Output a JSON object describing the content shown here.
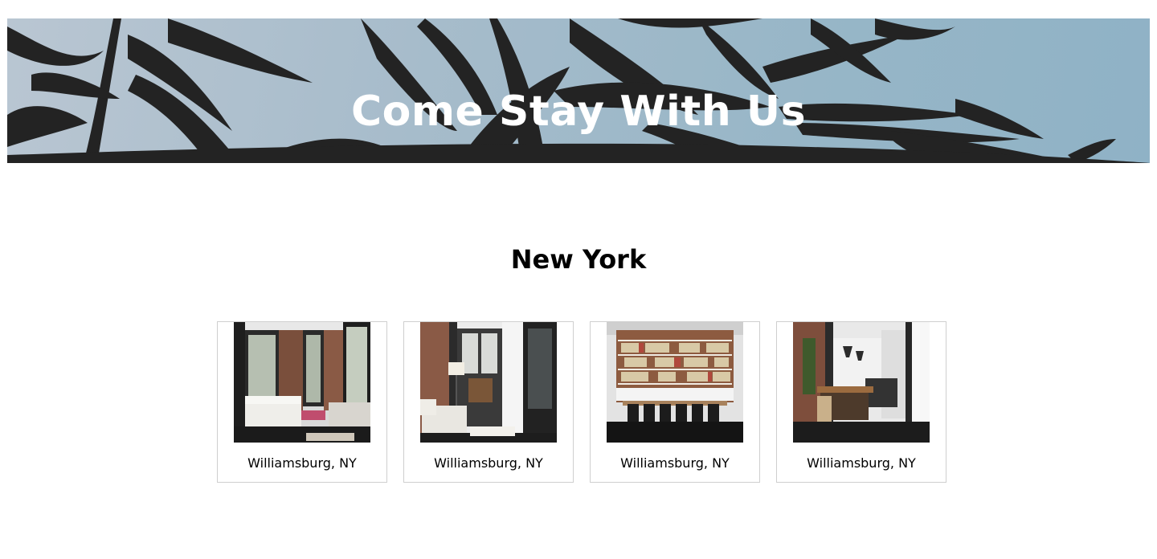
{
  "hero": {
    "title": "Come Stay With Us"
  },
  "section": {
    "title": "New York"
  },
  "listings": [
    {
      "caption": "Williamsburg, NY",
      "photo": "bedroom-loft-image"
    },
    {
      "caption": "Williamsburg, NY",
      "photo": "living-room-image"
    },
    {
      "caption": "Williamsburg, NY",
      "photo": "bookshelf-dining-image"
    },
    {
      "caption": "Williamsburg, NY",
      "photo": "kitchen-loft-image"
    }
  ]
}
